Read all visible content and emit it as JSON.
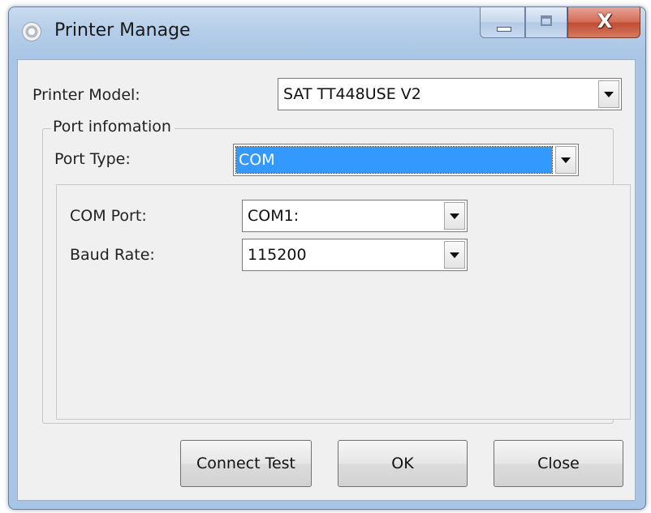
{
  "window": {
    "title": "Printer Manage",
    "icon": "gear-icon",
    "controls": {
      "minimize": "minimize-icon",
      "maximize": "maximize-icon",
      "close_label": "X"
    }
  },
  "printer_model": {
    "label": "Printer Model:",
    "value": "SAT TT448USE V2"
  },
  "port_info": {
    "group_label": "Port infomation",
    "port_type": {
      "label": "Port Type:",
      "value": "COM"
    },
    "com_port": {
      "label": "COM Port:",
      "value": "COM1:"
    },
    "baud_rate": {
      "label": "Baud Rate:",
      "value": "115200"
    }
  },
  "buttons": {
    "connect_test": "Connect Test",
    "ok": "OK",
    "close": "Close"
  },
  "colors": {
    "selection": "#3399ff",
    "close_button": "#c75a40",
    "titlebar": "#b4cde8"
  }
}
